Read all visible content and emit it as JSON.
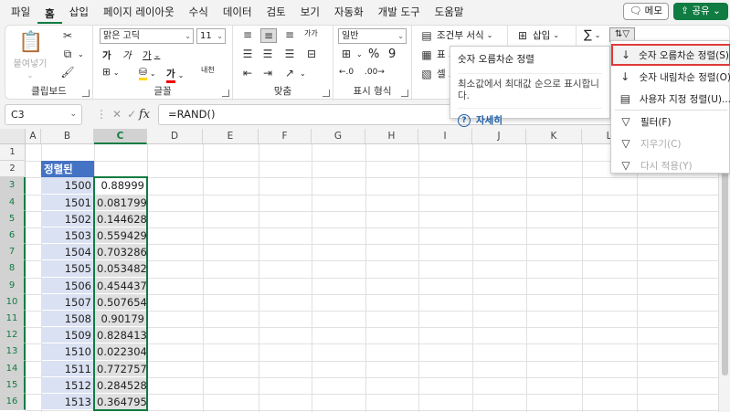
{
  "tabs": [
    "파일",
    "홈",
    "삽입",
    "페이지 레이아웃",
    "수식",
    "데이터",
    "검토",
    "보기",
    "자동화",
    "개발 도구",
    "도움말"
  ],
  "active_tab": "홈",
  "memo_label": "메모",
  "share_label": "공유",
  "ribbon": {
    "clipboard": {
      "paste_label": "붙여넣기",
      "label": "클립보드"
    },
    "font": {
      "name": "맑은 고딕",
      "size": "11",
      "label": "글꼴"
    },
    "align": {
      "label": "맞춤"
    },
    "number": {
      "format": "일반",
      "label": "표시 형식"
    },
    "styles": {
      "cond_label": "조건부 서식",
      "table_label": "표 서",
      "cell_label": "셀 스"
    },
    "cells": {
      "insert_label": "삽입"
    }
  },
  "namebox": "C3",
  "formula": "=RAND()",
  "columns": [
    "A",
    "B",
    "C",
    "D",
    "E",
    "F",
    "G",
    "H",
    "I",
    "J",
    "K",
    "L"
  ],
  "selected_column": "C",
  "rows": [
    "1",
    "2",
    "3",
    "4",
    "5",
    "6",
    "7",
    "8",
    "9",
    "10",
    "11",
    "12",
    "13",
    "14",
    "15",
    "16"
  ],
  "header_cell": "정렬된",
  "table_rows": [
    {
      "b": "1500",
      "c": "0.88999"
    },
    {
      "b": "1501",
      "c": "0.081799"
    },
    {
      "b": "1502",
      "c": "0.144628"
    },
    {
      "b": "1503",
      "c": "0.559429"
    },
    {
      "b": "1504",
      "c": "0.703286"
    },
    {
      "b": "1505",
      "c": "0.053482"
    },
    {
      "b": "1506",
      "c": "0.454437"
    },
    {
      "b": "1507",
      "c": "0.507654"
    },
    {
      "b": "1508",
      "c": "0.90179"
    },
    {
      "b": "1509",
      "c": "0.828413"
    },
    {
      "b": "1510",
      "c": "0.022304"
    },
    {
      "b": "1511",
      "c": "0.772757"
    },
    {
      "b": "1512",
      "c": "0.284528"
    },
    {
      "b": "1513",
      "c": "0.364795"
    }
  ],
  "tooltip": {
    "title": "숫자 오름차순 정렬",
    "desc": "최소값에서 최대값 순으로 표시합니다.",
    "more": "자세히"
  },
  "sort_menu": [
    {
      "label": "숫자 오름차순 정렬(S)",
      "icon": "sort-ascending-icon"
    },
    {
      "label": "숫자 내림차순 정렬(O)",
      "icon": "sort-descending-icon"
    },
    {
      "label": "사용자 지정 정렬(U)...",
      "icon": "custom-sort-icon"
    },
    {
      "label": "필터(F)",
      "icon": "filter-icon"
    },
    {
      "label": "지우기(C)",
      "icon": "clear-filter-icon"
    },
    {
      "label": "다시 적용(Y)",
      "icon": "reapply-icon"
    }
  ],
  "colors": {
    "accent": "#107c41",
    "header_blue": "#4472c4",
    "band_blue": "#d9e1f2",
    "highlight_red": "#e03a3a"
  }
}
